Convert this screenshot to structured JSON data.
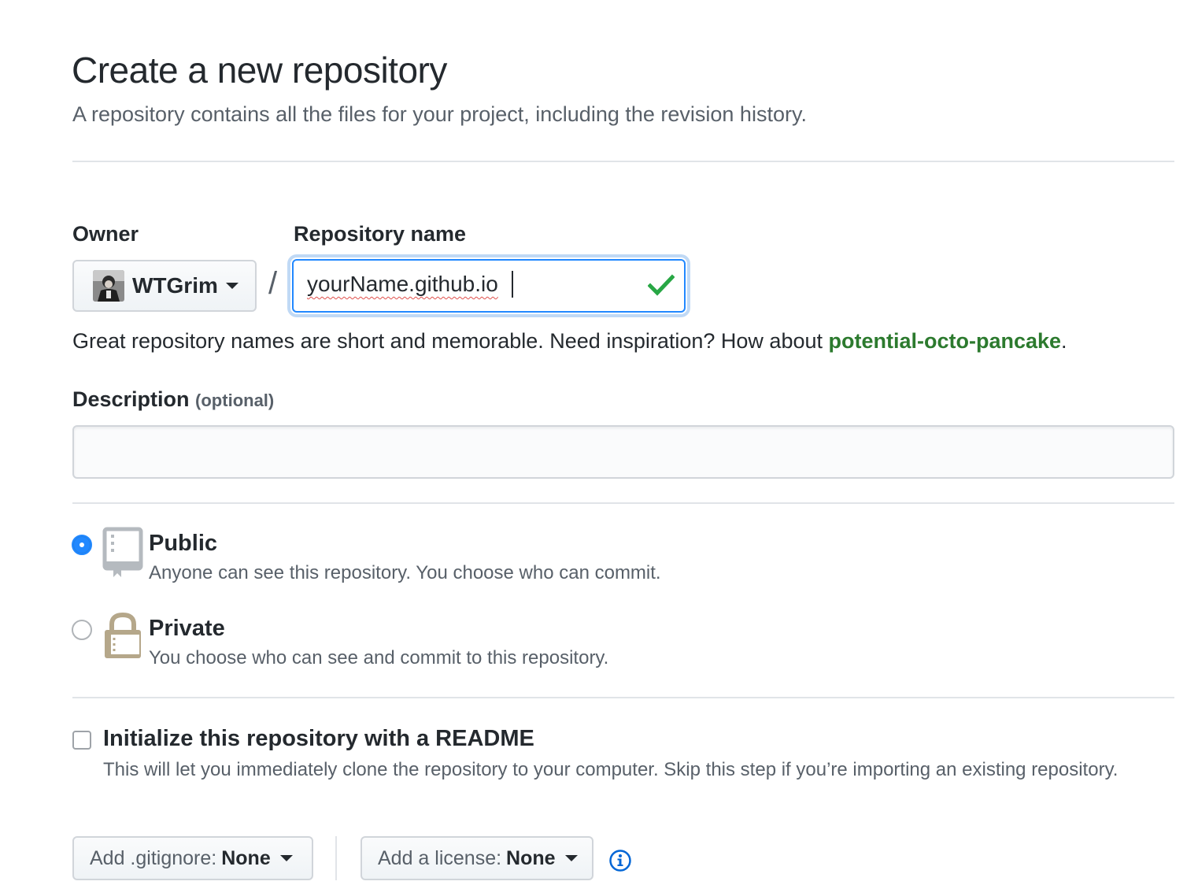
{
  "header": {
    "title": "Create a new repository",
    "subtitle": "A repository contains all the files for your project, including the revision history."
  },
  "owner": {
    "label": "Owner",
    "name": "WTGrim"
  },
  "repository": {
    "label": "Repository name",
    "value": "yourName.github.io",
    "separator": "/",
    "hint_prefix": "Great repository names are short and memorable. Need inspiration? How about ",
    "suggestion": "potential-octo-pancake",
    "hint_suffix": "."
  },
  "description": {
    "label": "Description",
    "optional": "(optional)",
    "value": ""
  },
  "visibility": {
    "selected": "public",
    "options": [
      {
        "title": "Public",
        "desc": "Anyone can see this repository. You choose who can commit."
      },
      {
        "title": "Private",
        "desc": "You choose who can see and commit to this repository."
      }
    ]
  },
  "readme": {
    "title": "Initialize this repository with a README",
    "desc": "This will let you immediately clone the repository to your computer. Skip this step if you’re importing an existing repository.",
    "checked": false
  },
  "gitignore": {
    "prefix": "Add .gitignore:",
    "value": "None"
  },
  "license": {
    "prefix": "Add a license:",
    "value": "None"
  },
  "colors": {
    "accent": "#2188ff",
    "success": "#28a745",
    "suggestion": "#2c7a2e",
    "text": "#24292e",
    "muted": "#586069",
    "lock": "#b5a78a"
  }
}
